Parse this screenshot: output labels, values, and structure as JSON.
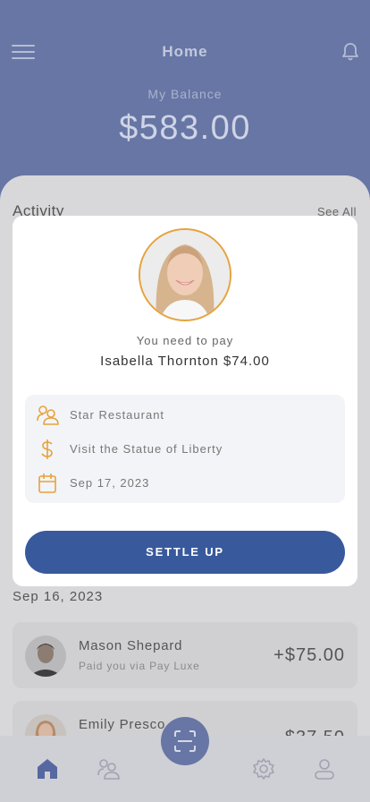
{
  "header": {
    "title": "Home",
    "balance_label": "My Balance",
    "balance": "$583.00"
  },
  "activity": {
    "title": "Activity",
    "see_all": "See All",
    "date_heading": "Sep 16, 2023",
    "transactions": [
      {
        "name": "Mason Shepard",
        "subtitle": "Paid you via Pay Luxe",
        "amount": "+$75.00"
      },
      {
        "name": "Emily Presco",
        "subtitle": "",
        "amount": "-$37.50"
      }
    ]
  },
  "modal": {
    "pay_label": "You need to pay",
    "payee": "Isabella Thornton $74.00",
    "details": [
      {
        "icon": "group-icon",
        "text": "Star Restaurant"
      },
      {
        "icon": "dollar-icon",
        "text": "Visit the Statue of Liberty"
      },
      {
        "icon": "calendar-icon",
        "text": "Sep 17, 2023"
      }
    ],
    "button": "SETTLE UP"
  },
  "nav": {
    "items": [
      "home-icon",
      "friends-icon",
      "scan-icon",
      "settings-icon",
      "profile-icon"
    ]
  },
  "colors": {
    "primary": "#38599c",
    "header": "#6776a4",
    "accent": "#e6a23c"
  }
}
